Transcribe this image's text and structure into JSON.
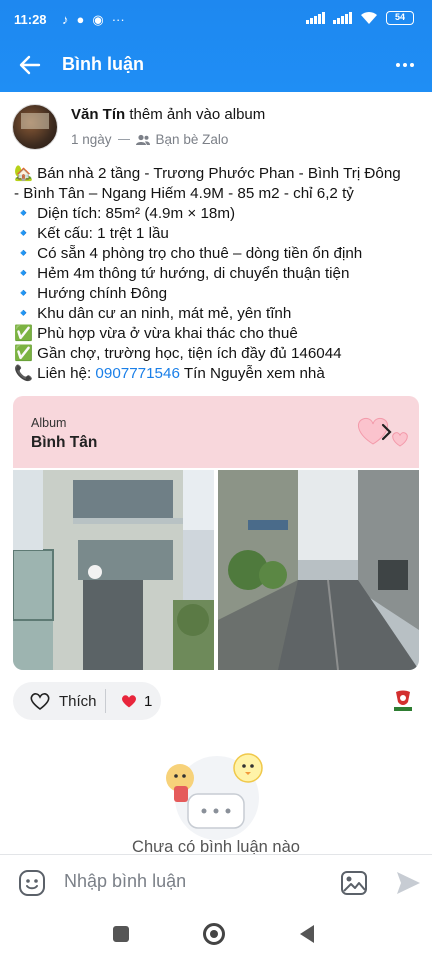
{
  "status_bar": {
    "time": "11:28",
    "notif_icons": [
      "tiktok-icon",
      "chat-bubble-icon",
      "messenger-icon"
    ],
    "more": "···",
    "battery": "54"
  },
  "app_bar": {
    "title": "Bình luận"
  },
  "post": {
    "author": "Văn Tín",
    "action": " thêm ảnh vào album",
    "time": "1 ngày",
    "audience": "Bạn bè Zalo",
    "lines": [
      {
        "icon": "🏡",
        "text": " Bán nhà 2 tầng - Trương Phước Phan - Bình Trị Đông"
      },
      {
        "icon": "",
        "text": "- Bình Tân – Ngang Hiếm 4.9M - 85 m2 - chỉ 6,2 tỷ"
      },
      {
        "icon": "🔹",
        "text": " Diện tích: 85m² (4.9m × 18m)"
      },
      {
        "icon": "🔹",
        "text": " Kết cấu: 1 trệt 1 lầu"
      },
      {
        "icon": "🔹",
        "text": " Có sẵn 4 phòng trọ cho thuê – dòng tiền ổn định"
      },
      {
        "icon": "🔹",
        "text": " Hẻm 4m thông tứ hướng, di chuyển thuận tiện"
      },
      {
        "icon": "🔹",
        "text": " Hướng chính Đông"
      },
      {
        "icon": "🔹",
        "text": " Khu dân cư an ninh, mát mẻ, yên tĩnh"
      },
      {
        "icon": "✅",
        "text": " Phù hợp vừa ở vừa khai thác cho thuê"
      },
      {
        "icon": "✅",
        "text": " Gần chợ, trường học, tiện ích đầy đủ 146044"
      }
    ],
    "contact_icon": "📞",
    "contact_label": " Liên hệ: ",
    "contact_phone": "0907771546",
    "contact_suffix": " Tín Nguyễn xem nhà"
  },
  "album": {
    "label": "Album",
    "name": "Bình Tân"
  },
  "reactions": {
    "like_label": "Thích",
    "heart_count": "1"
  },
  "comments": {
    "empty_text": "Chưa có bình luận nào"
  },
  "comment_bar": {
    "placeholder": "Nhập bình luận"
  },
  "colors": {
    "accent": "#1f8ef5",
    "album_header": "#f8d7dc",
    "link": "#1a7fe8"
  }
}
